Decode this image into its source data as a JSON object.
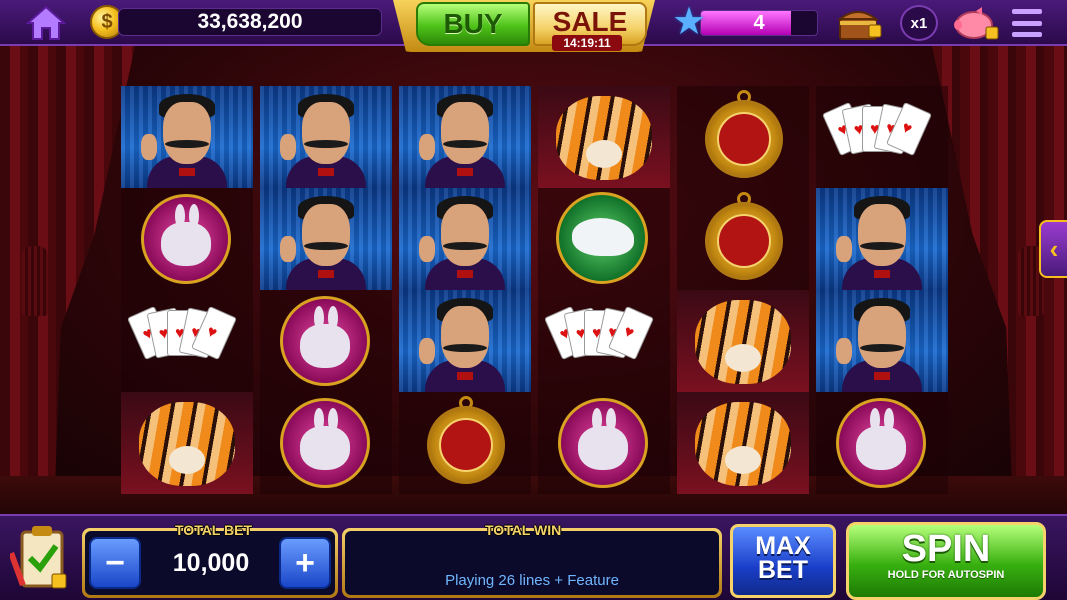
{
  "topbar": {
    "balance": "33,638,200",
    "buy_label": "BUY",
    "sale_label": "SALE",
    "sale_timer": "14:19:11",
    "level": "4",
    "level_progress_pct": 78,
    "multiplier": "x1",
    "coin_symbol": "$"
  },
  "reels": [
    [
      "magician",
      "rabbit",
      "cards",
      "tiger"
    ],
    [
      "magician",
      "magician",
      "rabbit",
      "rabbit"
    ],
    [
      "magician",
      "magician",
      "magician",
      "watch"
    ],
    [
      "tiger",
      "dove",
      "cards",
      "rabbit"
    ],
    [
      "watch",
      "watch",
      "tiger",
      "tiger"
    ],
    [
      "cards",
      "magician",
      "magician",
      "rabbit"
    ]
  ],
  "bottom": {
    "total_bet_label": "TOTAL BET",
    "total_bet_value": "10,000",
    "minus_label": "−",
    "plus_label": "+",
    "total_win_label": "TOTAL WIN",
    "total_win_value": "",
    "playing_text": "Playing  26 lines + Feature",
    "maxbet_line1": "MAX",
    "maxbet_line2": "BET",
    "spin_label": "SPIN",
    "spin_sub": "HOLD FOR AUTOSPIN"
  },
  "side_arrow": "‹",
  "icons": [
    "home-icon",
    "coin-icon",
    "star-icon",
    "treasure-chest-icon",
    "piggy-bank-icon",
    "menu-icon",
    "paytable-icon"
  ],
  "colors": {
    "accent_gold": "#f5d36a",
    "topbar_purple": "#4a1a7a",
    "spin_green": "#38b010",
    "bet_blue": "#1a46c8"
  }
}
